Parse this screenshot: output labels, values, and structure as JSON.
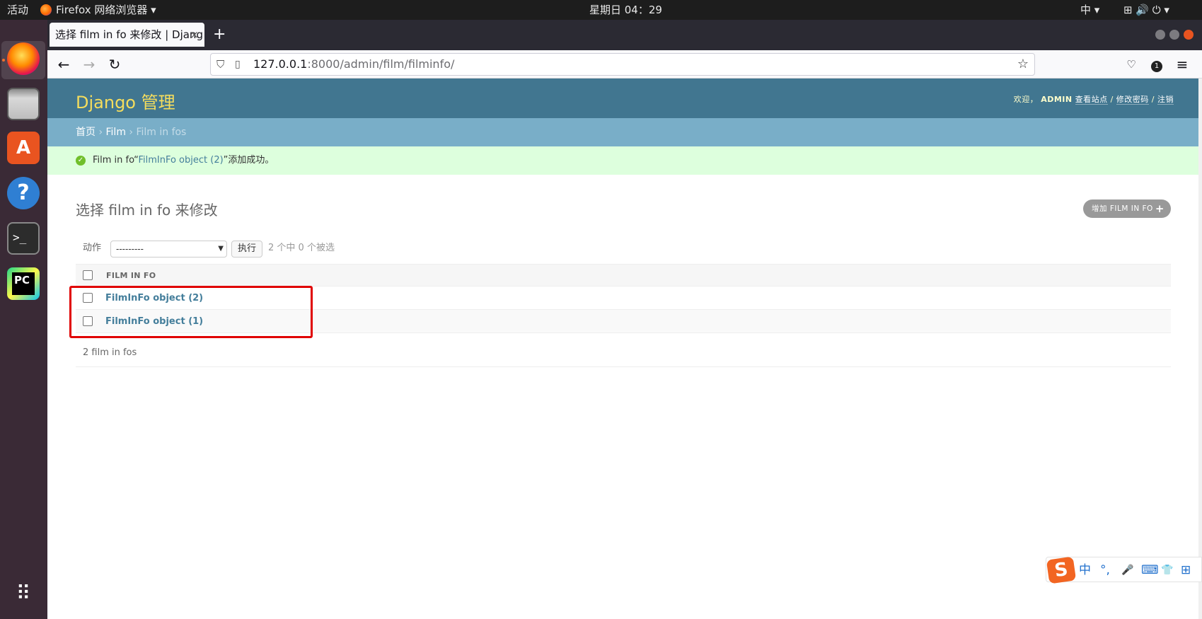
{
  "topbar": {
    "activities": "活动",
    "app_menu": "Firefox 网络浏览器 ▾",
    "clock": "星期日 04：29",
    "input_method": "中 ▾",
    "status_icons": "⊞ 🔊 ⏻ ▾"
  },
  "dock": {
    "apps": [
      "firefox-icon",
      "files-icon",
      "software-center-icon",
      "help-icon",
      "terminal-icon",
      "pycharm-icon",
      "app-grid-icon"
    ]
  },
  "browser": {
    "tab_title": "选择 film in fo 来修改 | Djang",
    "tab_close": "×",
    "new_tab": "+",
    "url_host": "127.0.0.1",
    "url_path": ":8000/admin/film/filminfo/",
    "extension_badge": "1"
  },
  "django": {
    "brand": "Django 管理",
    "user_tools": {
      "welcome": "欢迎，",
      "username": "ADMIN",
      "view_site": "查看站点",
      "sep1": " / ",
      "change_password": "修改密码",
      "sep2": " / ",
      "logout": "注销"
    },
    "breadcrumbs": {
      "home": "首页",
      "sep": " › ",
      "app": "Film",
      "current": "Film in fos"
    },
    "message": {
      "prefix": "Film in fo“",
      "link": "FilmInFo object (2)",
      "suffix": "”添加成功。"
    },
    "title": "选择 film in fo 来修改",
    "add_button": "增加 FILM IN FO",
    "actions": {
      "label": "动作",
      "selected_option": "---------",
      "go_button": "执行",
      "counter": "2 个中 0 个被选"
    },
    "table": {
      "column_header": "FILM IN FO",
      "rows": [
        "FilmInFo object (2)",
        "FilmInFo object (1)"
      ]
    },
    "paginator": "2 film in fos"
  },
  "ime": {
    "items": [
      "中",
      "°,",
      "🎤",
      "⌨",
      "👕",
      "⊞"
    ]
  },
  "colors": {
    "header_bg": "#417690",
    "brand_yellow": "#f5dd5d",
    "breadcrumb_bg": "#79aec8",
    "success_bg": "#ddffdd",
    "link_blue": "#447e9b",
    "annotation_red": "#e00000"
  }
}
